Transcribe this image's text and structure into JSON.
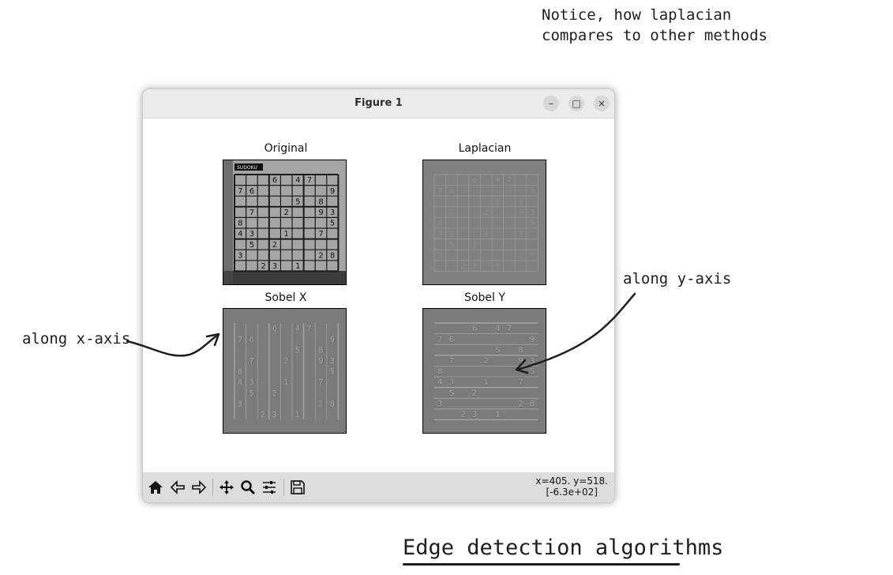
{
  "annotations": {
    "note_line1": "Notice, how laplacian",
    "note_line2": "compares to other methods",
    "x_axis_label": "along x-axis",
    "y_axis_label": "along y-axis",
    "caption": "Edge detection algorithms"
  },
  "window": {
    "title": "Figure 1",
    "minimize": "–",
    "maximize": "□",
    "close": "×"
  },
  "figure": {
    "panels": [
      {
        "title": "Original",
        "filter": "original"
      },
      {
        "title": "Laplacian",
        "filter": "laplacian"
      },
      {
        "title": "Sobel X",
        "filter": "sobel-x"
      },
      {
        "title": "Sobel Y",
        "filter": "sobel-y"
      }
    ],
    "sudoku_digits": [
      [
        0,
        0,
        0,
        6,
        0,
        4,
        7,
        0,
        0
      ],
      [
        7,
        6,
        0,
        0,
        0,
        0,
        0,
        0,
        9
      ],
      [
        0,
        0,
        0,
        0,
        0,
        5,
        0,
        8,
        0
      ],
      [
        0,
        7,
        0,
        0,
        2,
        0,
        0,
        9,
        3
      ],
      [
        8,
        0,
        0,
        0,
        0,
        0,
        0,
        0,
        5
      ],
      [
        4,
        3,
        0,
        0,
        1,
        0,
        0,
        7,
        0
      ],
      [
        0,
        5,
        0,
        2,
        0,
        0,
        0,
        0,
        0
      ],
      [
        3,
        0,
        0,
        0,
        0,
        0,
        0,
        2,
        8
      ],
      [
        0,
        0,
        2,
        3,
        0,
        1,
        0,
        0,
        0
      ]
    ],
    "sudoku_header": "SUDOKU"
  },
  "toolbar": {
    "tools": [
      "home-icon",
      "back-icon",
      "forward-icon",
      "pan-icon",
      "zoom-icon",
      "configure-subplots-icon",
      "save-icon"
    ],
    "coords_line1": "x=405. y=518.",
    "coords_line2": "[-6.3e+02]"
  }
}
